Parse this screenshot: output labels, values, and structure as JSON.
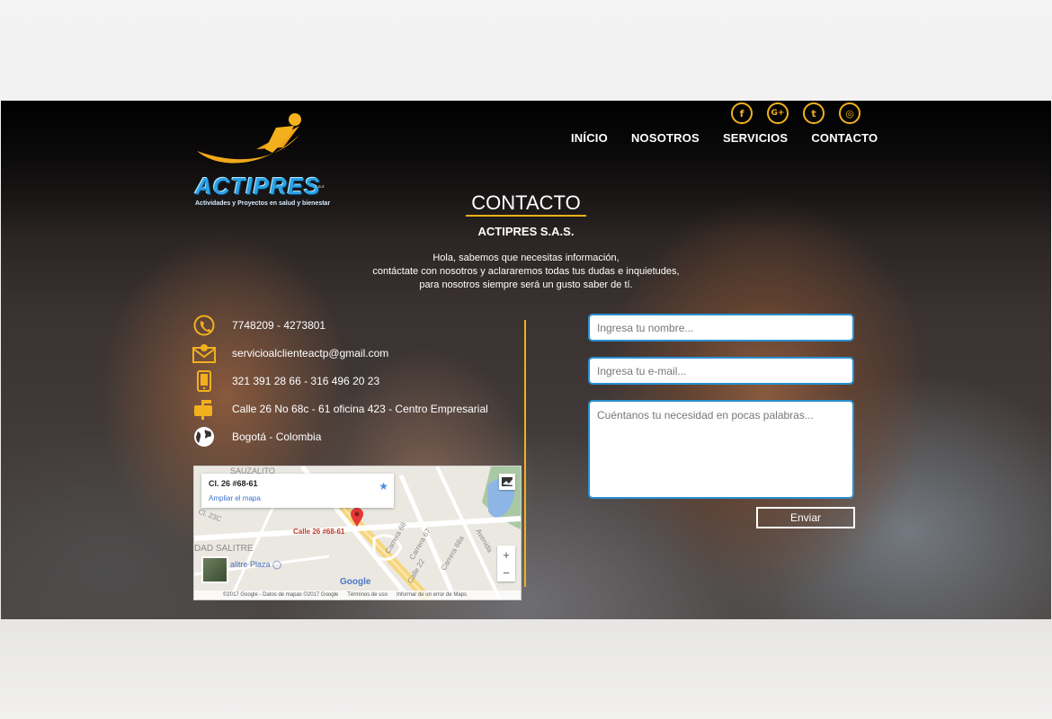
{
  "brand": {
    "name": "ACTIPRES",
    "sas_mark": "s.a.s",
    "tagline": "Actividades y Proyectos en salud y bienestar"
  },
  "social": [
    {
      "icon": "facebook-icon",
      "glyph": "f"
    },
    {
      "icon": "google-plus-icon",
      "glyph": "G+"
    },
    {
      "icon": "twitter-icon",
      "glyph": "t"
    },
    {
      "icon": "instagram-icon",
      "glyph": "◎"
    }
  ],
  "nav": {
    "items": [
      "INÍCIO",
      "NOSOTROS",
      "SERVICIOS",
      "CONTACTO"
    ]
  },
  "section": {
    "title": "CONTACTO",
    "company": "ACTIPRES S.A.S.",
    "intro_lines": [
      "Hola, sabemos que necesitas información,",
      "contáctate con nosotros y aclararemos todas tus dudas e inquietudes,",
      "para nosotros siempre será un gusto saber de tí."
    ]
  },
  "contact_info": [
    {
      "icon": "phone-icon",
      "text": "7748209 - 4273801"
    },
    {
      "icon": "email-icon",
      "text": "servicioalclienteactp@gmail.com"
    },
    {
      "icon": "mobile-icon",
      "text": "321 391 28 66 - 316 496 20 23"
    },
    {
      "icon": "mailbox-icon",
      "text": "Calle 26 No 68c - 61 oficina 423 - Centro Empresarial"
    },
    {
      "icon": "globe-icon",
      "text": "Bogotá - Colombia"
    }
  ],
  "map": {
    "card_address": "Cl. 26 #68-61",
    "card_link": "Ampliar el mapa",
    "pin_label": "Calle 26 #68-61",
    "area_label_top": "SAUZALITO",
    "area_label_left": "DAD SALITRE",
    "place_label": "alitre Plaza",
    "streets": [
      "Carrera 68",
      "Carrera 67",
      "Carrera 68a",
      "Calle 22",
      "Avenida",
      "Cl. 23C"
    ],
    "zoom_in": "+",
    "zoom_out": "−",
    "google": "Google",
    "footer": [
      "©2017 Google - Datos de mapas ©2017 Google",
      "Términos de uso",
      "Informar de un error de Maps"
    ]
  },
  "form": {
    "name_placeholder": "Ingresa tu nombre...",
    "email_placeholder": "Ingresa tu e-mail...",
    "message_placeholder": "Cuéntanos tu necesidad en pocas palabras...",
    "submit_label": "Enviar"
  },
  "colors": {
    "accent": "#f2b11c",
    "field_border": "#2a8fd1",
    "logo_blue": "#2aa3e6"
  }
}
